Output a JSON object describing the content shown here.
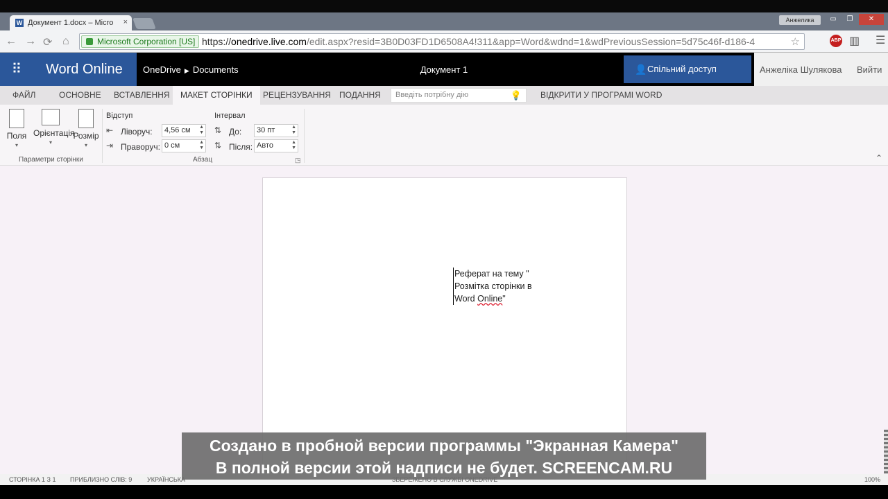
{
  "browser": {
    "tab_title": "Документ 1.docx – Micro",
    "tab_favicon": "W",
    "tab_close": "×",
    "profile_name": "Анжелика",
    "window_buttons": [
      "▭",
      "❐",
      "✕"
    ],
    "ev_label": "Microsoft Corporation [US]",
    "url_scheme": "https://",
    "url_host": "onedrive.live.com",
    "url_path": "/edit.aspx?resid=3B0D03FD1D6508A4!311&app=Word&wdnd=1&wdPreviousSession=5d75c46f-d186-4",
    "abp_label": "ABP",
    "nav_icons": [
      "←",
      "→",
      "⟳",
      "⌂"
    ]
  },
  "appbar": {
    "waffle_icon": "⠿",
    "brand": "Word Online",
    "breadcrumb_root": "OneDrive",
    "breadcrumb_sep": "▶",
    "breadcrumb_folder": "Documents",
    "document_title": "Документ 1",
    "share_label": "Спільний доступ",
    "user_name": "Анжеліка Шулякова",
    "sign_out": "Вийти"
  },
  "ribbon_tabs": [
    {
      "label": "ФАЙЛ"
    },
    {
      "label": "ОСНОВНЕ"
    },
    {
      "label": "ВСТАВЛЕННЯ"
    },
    {
      "label": "МАКЕТ СТОРІНКИ"
    },
    {
      "label": "РЕЦЕНЗУВАННЯ"
    },
    {
      "label": "ПОДАННЯ"
    },
    {
      "label": "ВІДКРИТИ У ПРОГРАМІ WORD"
    }
  ],
  "tell_me_placeholder": "Введіть потрібну дію",
  "ribbon": {
    "page_setup": {
      "margins": "Поля",
      "orientation": "Орієнтація",
      "size": "Розмір",
      "group_label": "Параметри сторінки"
    },
    "paragraph": {
      "indent_label": "Відступ",
      "left_label": "Ліворуч:",
      "left_value": "4,56 см",
      "right_label": "Праворуч:",
      "right_value": "0 см",
      "spacing_label": "Інтервал",
      "before_label": "До:",
      "before_value": "30 пт",
      "after_label": "Після:",
      "after_value": "Авто",
      "group_label": "Абзац"
    }
  },
  "document": {
    "line1": "Реферат на тему \"",
    "line2": "Розмітка сторінки в",
    "line3_pre": "Word ",
    "line3_squiggle": "Online",
    "line3_post": "\""
  },
  "watermark": {
    "line1": "Создано в пробной версии программы \"Экранная Камера\"",
    "line2": "В полной версии этой надписи не будет. SCREENCAM.RU"
  },
  "status": {
    "page": "СТОРІНКА 1 З 1",
    "words": "ПРИБЛИЗНО СЛІВ: 9",
    "language": "УКРАЇНСЬКА",
    "saved": "ЗБЕРЕЖЕНО В СЛУЖБІ ONEDRIVE",
    "zoom": "100%"
  }
}
